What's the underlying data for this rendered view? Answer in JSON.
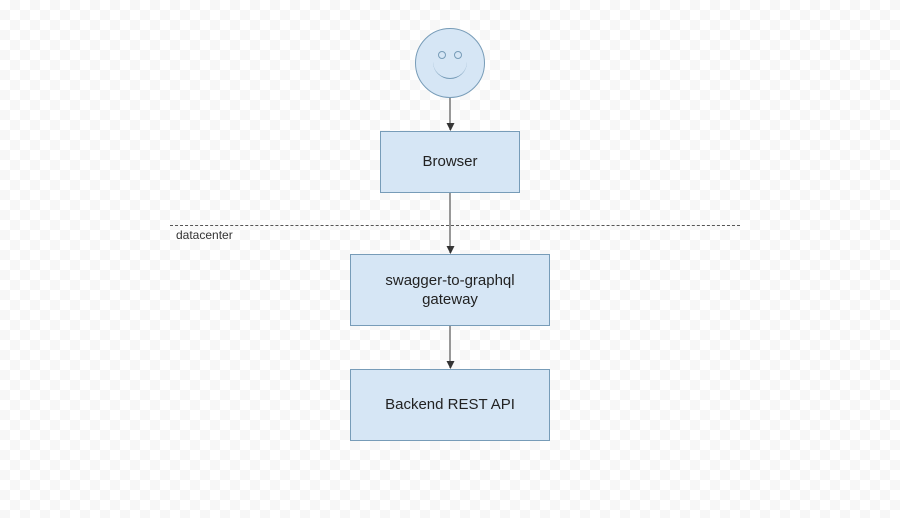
{
  "nodes": {
    "user": {
      "type": "actor",
      "icon": "smiley-face"
    },
    "browser": {
      "label": "Browser"
    },
    "gateway": {
      "label": "swagger-to-graphql\ngateway"
    },
    "backend": {
      "label": "Backend REST API"
    }
  },
  "boundary": {
    "label": "datacenter"
  },
  "edges": [
    {
      "from": "user",
      "to": "browser"
    },
    {
      "from": "browser",
      "to": "gateway"
    },
    {
      "from": "gateway",
      "to": "backend"
    }
  ],
  "colors": {
    "node_fill": "#d6e6f5",
    "node_stroke": "#779cb8",
    "arrow": "#333333"
  }
}
